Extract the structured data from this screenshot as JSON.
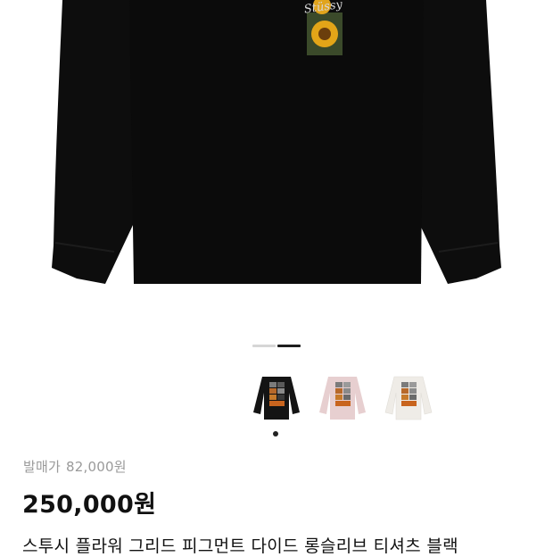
{
  "product": {
    "retail_label": "발매가",
    "retail_price": "82,000원",
    "price": "250,000원",
    "title": "스투시 플라워 그리드 피그먼트 다이드 롱슬리브 티셔츠 블랙"
  },
  "carousel": {
    "page_count": 2,
    "active_index": 1
  },
  "thumbnails": [
    {
      "color_name": "black",
      "shirt_color": "#141414"
    },
    {
      "color_name": "pink",
      "shirt_color": "#e7cfd0"
    },
    {
      "color_name": "white",
      "shirt_color": "#efece7"
    }
  ],
  "hero": {
    "shirt_color": "#0c0c0c",
    "logo_text": "Stüssy"
  }
}
